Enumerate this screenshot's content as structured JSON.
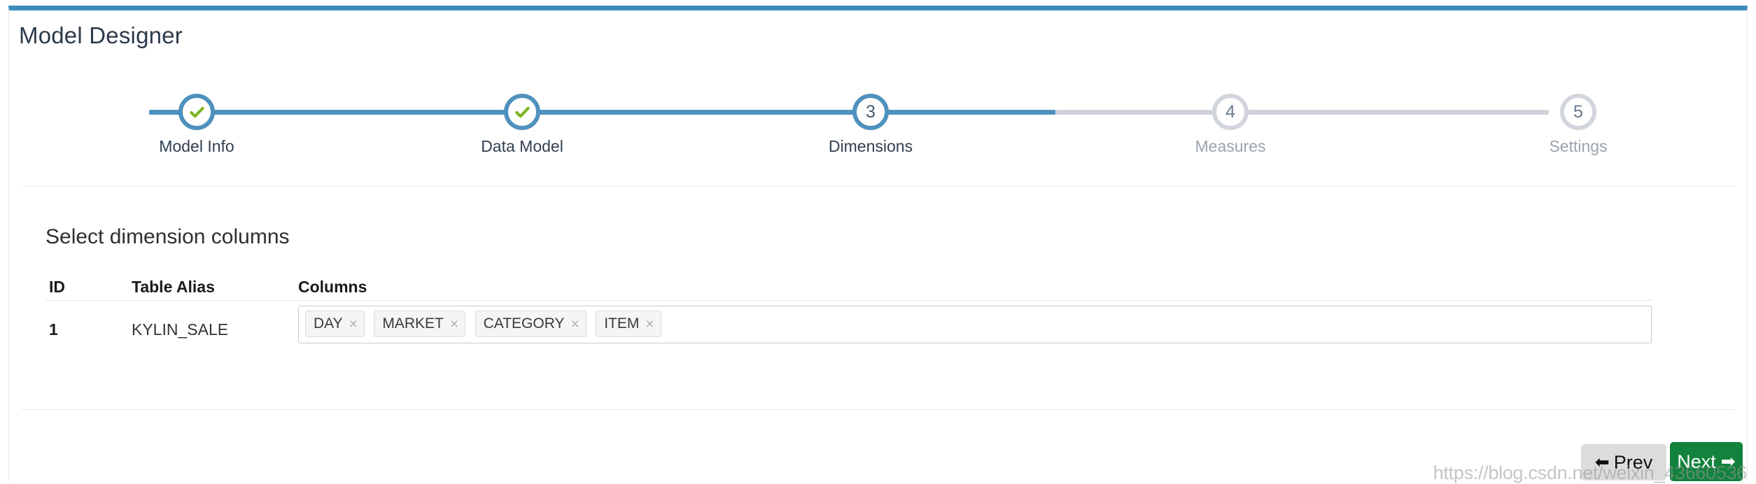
{
  "header": {
    "title": "Model Designer"
  },
  "stepper": {
    "steps": [
      {
        "label": "Model Info",
        "marker": "✓",
        "state": "done"
      },
      {
        "label": "Data Model",
        "marker": "✓",
        "state": "done"
      },
      {
        "label": "Dimensions",
        "marker": "3",
        "state": "active"
      },
      {
        "label": "Measures",
        "marker": "4",
        "state": "todo"
      },
      {
        "label": "Settings",
        "marker": "5",
        "state": "todo"
      }
    ],
    "colors": {
      "done": "#4f91be",
      "active": "#4f91be",
      "todo": "#d2d6dc",
      "check": "#7ab51d"
    }
  },
  "main": {
    "section_title": "Select dimension columns",
    "table": {
      "headers": {
        "id": "ID",
        "alias": "Table Alias",
        "columns": "Columns"
      },
      "rows": [
        {
          "id": "1",
          "alias": "KYLIN_SALE",
          "columns": [
            "DAY",
            "MARKET",
            "CATEGORY",
            "ITEM"
          ],
          "remove_glyph": "×"
        }
      ]
    }
  },
  "footer": {
    "prev_label": "Prev",
    "prev_icon": "⬅",
    "next_label": "Next",
    "next_icon": "➡",
    "next_color": "#12823c"
  },
  "watermark": {
    "text": "https://blog.csdn.net/weixin_43660536"
  }
}
